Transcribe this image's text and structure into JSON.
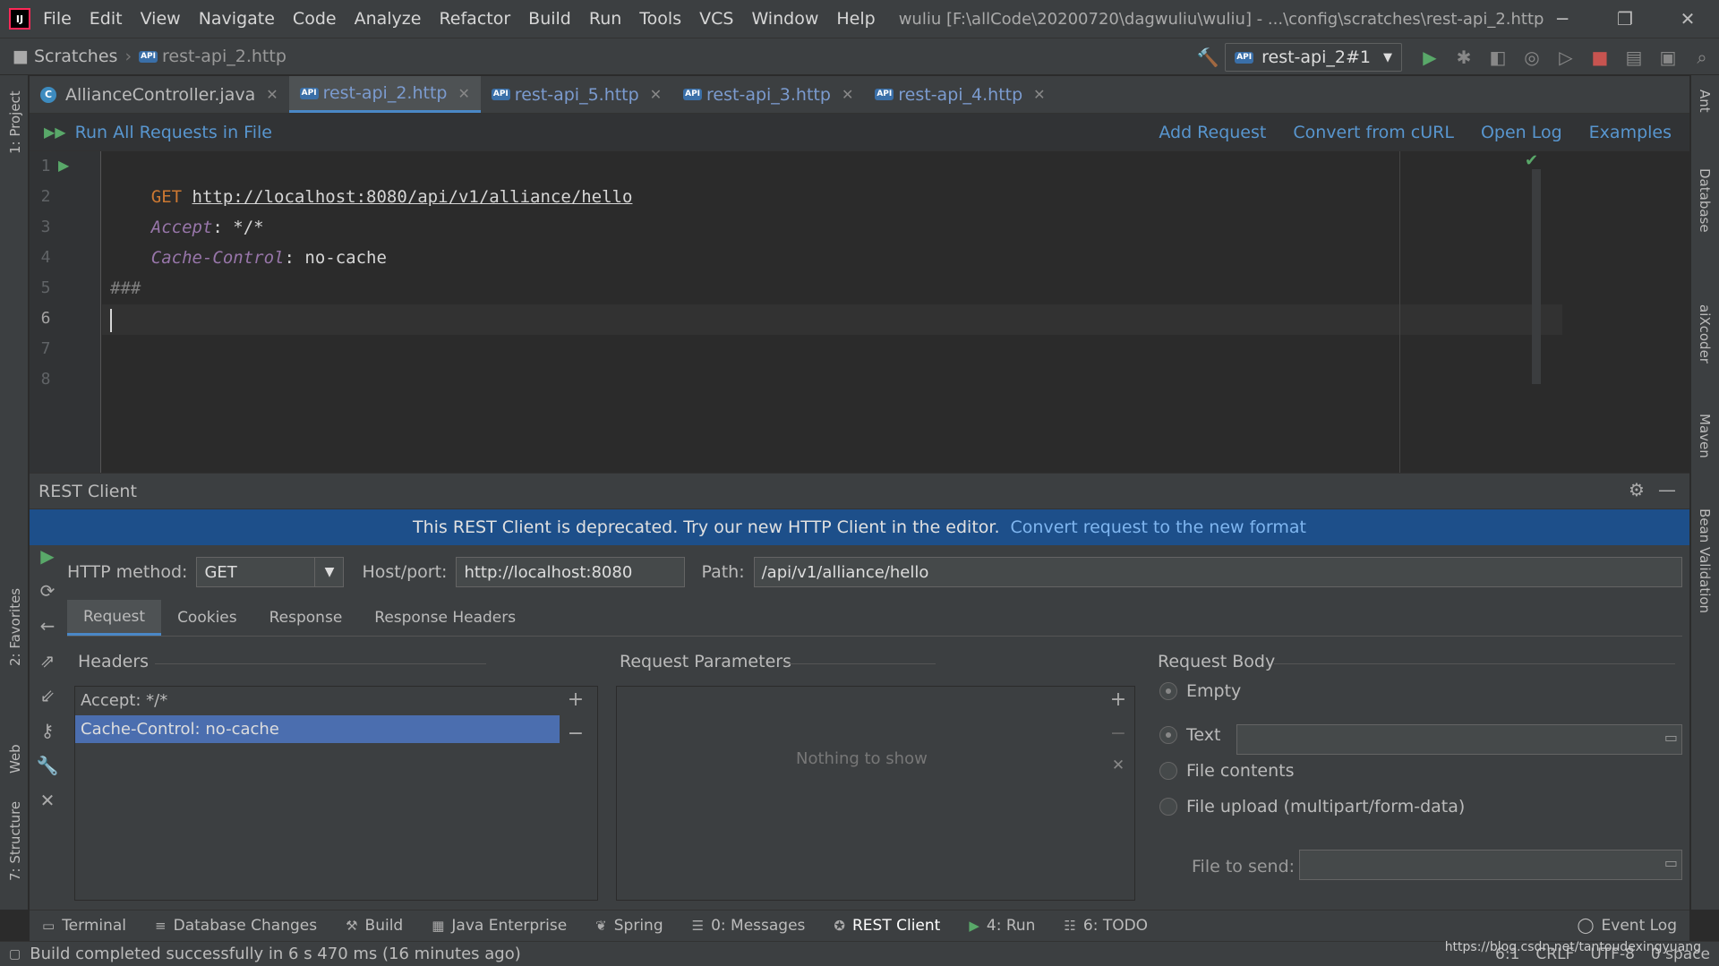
{
  "window": {
    "title": "wuliu [F:\\allCode\\20200720\\dagwuliu\\wuliu] - ...\\config\\scratches\\rest-api_2.http",
    "menu": [
      "File",
      "Edit",
      "View",
      "Navigate",
      "Code",
      "Analyze",
      "Refactor",
      "Build",
      "Run",
      "Tools",
      "VCS",
      "Window",
      "Help"
    ]
  },
  "breadcrumb": {
    "folder": "Scratches",
    "file": "rest-api_2.http"
  },
  "toolbar": {
    "run_config": "rest-api_2#1"
  },
  "left_strip": {
    "project": "1: Project",
    "favorites": "2: Favorites",
    "web": "Web",
    "structure": "7: Structure"
  },
  "right_strip": {
    "ant": "Ant",
    "database": "Database",
    "aixcoder": "aiXcoder",
    "maven": "Maven",
    "bean_validation": "Bean Validation"
  },
  "tabs": [
    {
      "label": "AllianceController.java",
      "icon": "java-class-icon",
      "active": false
    },
    {
      "label": "rest-api_2.http",
      "icon": "api-icon",
      "active": true
    },
    {
      "label": "rest-api_5.http",
      "icon": "api-icon",
      "active": false
    },
    {
      "label": "rest-api_3.http",
      "icon": "api-icon",
      "active": false
    },
    {
      "label": "rest-api_4.http",
      "icon": "api-icon",
      "active": false
    }
  ],
  "http_toolbar": {
    "run_all": "Run All Requests in File",
    "add_request": "Add Request",
    "convert_curl": "Convert from cURL",
    "open_log": "Open Log",
    "examples": "Examples"
  },
  "editor": {
    "line_numbers": [
      "1",
      "2",
      "3",
      "4",
      "5",
      "6",
      "7",
      "8"
    ],
    "line1_method": "GET",
    "line1_url": "http://localhost:8080/api/v1/alliance/hello",
    "line2_name": "Accept",
    "line2_value": " */*",
    "line3_name": "Cache-Control",
    "line3_value": " no-cache",
    "line5": "###",
    "colon": ":"
  },
  "rest_client": {
    "title": "REST Client",
    "deprecation_text": "This REST Client is deprecated. Try our new HTTP Client in the editor.",
    "deprecation_link": "Convert request to the new format",
    "http_method_label": "HTTP method:",
    "http_method_value": "GET",
    "host_label": "Host/port:",
    "host_value": "http://localhost:8080",
    "path_label": "Path:",
    "path_value": "/api/v1/alliance/hello",
    "sub_tabs": [
      "Request",
      "Cookies",
      "Response",
      "Response Headers"
    ],
    "headers_title": "Headers",
    "headers": [
      "Accept: */*",
      "Cache-Control: no-cache"
    ],
    "params_title": "Request Parameters",
    "params_empty": "Nothing to show",
    "body_title": "Request Body",
    "body_options": [
      "Empty",
      "Text",
      "File contents",
      "File upload (multipart/form-data)"
    ],
    "file_to_send_label": "File to send:"
  },
  "tool_tabs": [
    "Terminal",
    "Database Changes",
    "Build",
    "Java Enterprise",
    "Spring",
    "0: Messages",
    "REST Client",
    "4: Run",
    "6: TODO"
  ],
  "event_log": "Event Log",
  "status": {
    "message": "Build completed successfully in 6 s 470 ms (16 minutes ago)",
    "position": "6:1",
    "line_sep": "CRLF",
    "encoding": "UTF-8",
    "indent": "0 space",
    "watermark": "https://blog.csdn.net/tantoudexingyuang"
  },
  "colors": {
    "accent": "#4a88c7",
    "link": "#5896cf",
    "banner": "#1d4f8a",
    "selection": "#4b6eaf",
    "run_green": "#59a869"
  }
}
